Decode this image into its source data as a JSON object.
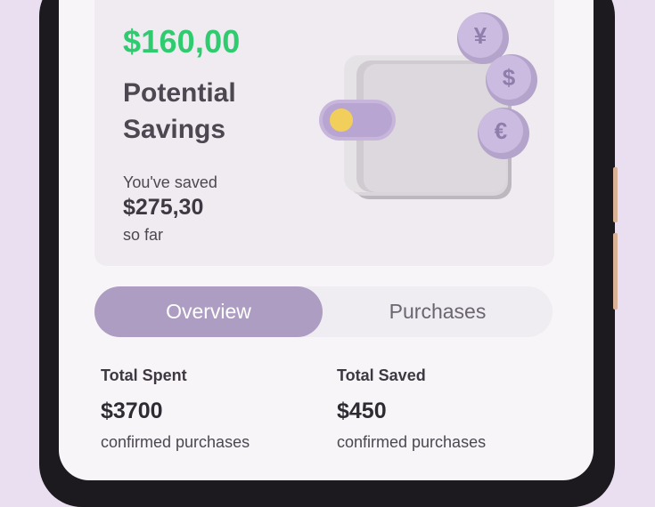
{
  "savings": {
    "potential_amount": "$160,00",
    "title_line1": "Potential",
    "title_line2": "Savings",
    "saved_caption": "You've saved",
    "saved_amount": "$275,30",
    "saved_suffix": "so far"
  },
  "tabs": [
    {
      "label": "Overview",
      "active": true
    },
    {
      "label": "Purchases",
      "active": false
    }
  ],
  "stats": [
    {
      "label": "Total Spent",
      "value": "$3700",
      "sub": "confirmed purchases"
    },
    {
      "label": "Total Saved",
      "value": "$450",
      "sub": "confirmed purchases"
    }
  ],
  "illustration": {
    "icon": "wallet-icon",
    "coin_symbols": [
      "¥",
      "$",
      "€"
    ]
  },
  "colors": {
    "accent_green": "#2ecb6f",
    "tab_active": "#ae9dc2",
    "background": "#e9dff1"
  }
}
